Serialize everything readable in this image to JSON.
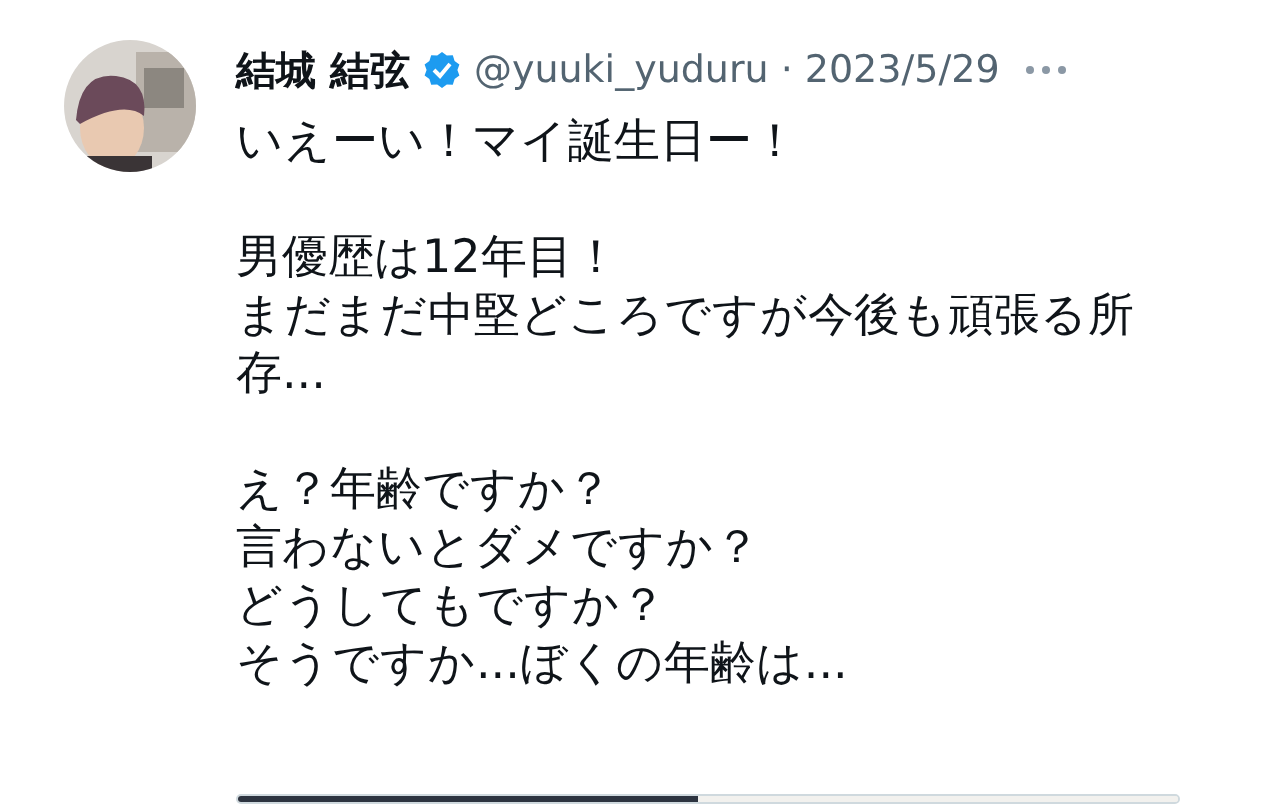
{
  "author": {
    "name": "結城 結弦",
    "verified": true,
    "handle": "@yuuki_yuduru",
    "separator": "·",
    "date": "2023/5/29"
  },
  "paragraphs": [
    [
      "いえーい！マイ誕生日ー！"
    ],
    [
      "男優歴は12年目！",
      "まだまだ中堅どころですが今後も頑張る所",
      "存..."
    ],
    [
      "え？年齢ですか？",
      "言わないとダメですか？",
      "どうしてもですか？",
      "そうですか...ぼくの年齢は..."
    ]
  ],
  "media": {
    "kind": "picture"
  }
}
